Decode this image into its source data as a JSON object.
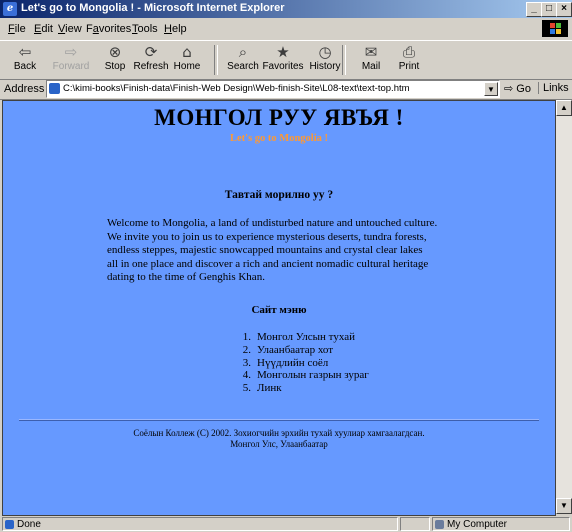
{
  "window": {
    "title": "Let's go to Mongolia ! - Microsoft Internet Explorer",
    "controls": {
      "minimize": "_",
      "maximize": "□",
      "close": "×"
    }
  },
  "menubar": {
    "items": [
      {
        "key": "F",
        "rest": "ile"
      },
      {
        "key": "E",
        "rest": "dit"
      },
      {
        "key": "V",
        "rest": "iew"
      },
      {
        "pre": "F",
        "key": "a",
        "rest": "vorites"
      },
      {
        "key": "T",
        "rest": "ools"
      },
      {
        "key": "H",
        "rest": "elp"
      }
    ]
  },
  "toolbar": {
    "back": "Back",
    "forward": "Forward",
    "stop": "Stop",
    "refresh": "Refresh",
    "home": "Home",
    "search": "Search",
    "favorites": "Favorites",
    "history": "History",
    "mail": "Mail",
    "print": "Print"
  },
  "address": {
    "label": "Address",
    "url": "C:\\kimi-books\\Finish-data\\Finish-Web Design\\Web-finish-Site\\L08-text\\text-top.htm",
    "go": "Go",
    "links": "Links »"
  },
  "page": {
    "heading": "МОНГОЛ РУУ ЯВЪЯ !",
    "subheading": "Let's go to Mongolia !",
    "question": "Тавтай морилно уу ?",
    "welcome_lines": [
      "Welcome to Mongolia, a land of undisturbed nature and untouched culture.",
      "We invite you to join us to experience mysterious deserts, tundra forests,",
      "endless steppes, majestic snowcapped mountains and crystal clear lakes",
      "all in one place and discover a rich and ancient nomadic cultural heritage",
      "dating to the time of Genghis Khan."
    ],
    "sitemap_title": "Сайт мэню",
    "menu": [
      {
        "num": "1.",
        "label": "Монгол Улсын тухай"
      },
      {
        "num": "2.",
        "label": "Улаанбаатар хот"
      },
      {
        "num": "3.",
        "label": "Нүүдлийн соёл"
      },
      {
        "num": "4.",
        "label": "Монголын газрын зураг"
      },
      {
        "num": "5.",
        "label": "Линк"
      }
    ],
    "footer_line1": "Соёлын Коллеж (C) 2002. Зохиогчийн эрхийн тухай хуулиар хамгаалагдсан.",
    "footer_line2": "Монгол Улс, Улаанбаатар"
  },
  "status": {
    "text": "Done",
    "zone": "My Computer"
  },
  "colors": {
    "page_background": "#6699ff",
    "subheading": "#ff9933"
  }
}
